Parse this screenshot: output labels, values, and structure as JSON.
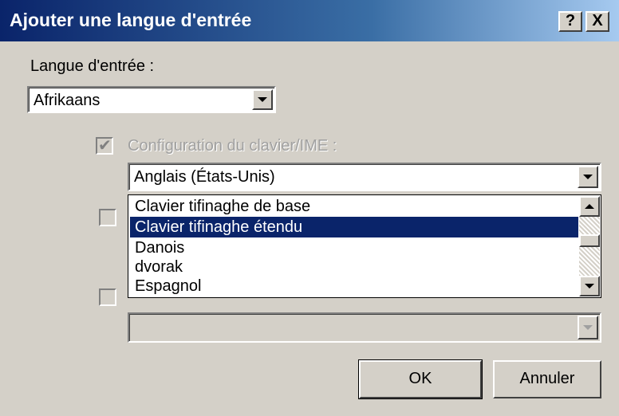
{
  "window": {
    "title": "Ajouter une langue d'entrée",
    "help_label": "?",
    "close_label": "X"
  },
  "input_language": {
    "label": "Langue d'entrée :",
    "value": "Afrikaans"
  },
  "keyboard_layout": {
    "checkbox_label": "Configuration du clavier/IME :",
    "checked": true,
    "enabled": false,
    "value": "Anglais (États-Unis)",
    "options_visible": [
      "Clavier tifinaghe de base",
      "Clavier tifinaghe étendu",
      "Danois",
      "dvorak",
      "Espagnol"
    ],
    "highlighted_option": "Clavier tifinaghe étendu"
  },
  "speech": {
    "checked": false,
    "enabled": false
  },
  "dialect": {
    "checked": false,
    "enabled": false,
    "value": ""
  },
  "buttons": {
    "ok_label": "OK",
    "cancel_label": "Annuler"
  },
  "icons": {
    "dropdown": "chevron-down-icon",
    "scroll_up": "arrow-up-icon",
    "scroll_down": "arrow-down-icon",
    "check": "checkmark-icon"
  },
  "colors": {
    "titlebar_start": "#0a246a",
    "titlebar_end": "#a6caf0",
    "selection": "#0a246a",
    "face": "#d4d0c8"
  }
}
